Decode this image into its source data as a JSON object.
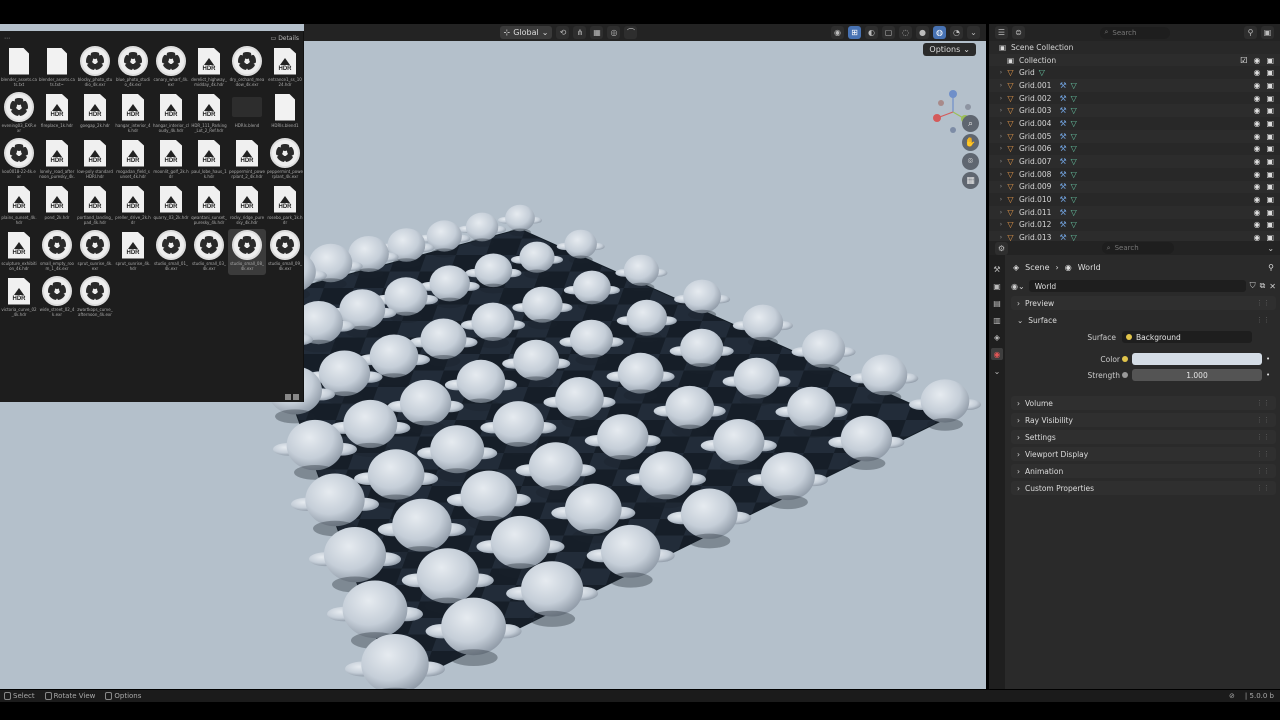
{
  "viewport": {
    "orientation": "Global",
    "options_label": "Options"
  },
  "file_browser": {
    "details_label": "Details",
    "items": [
      {
        "label": "blender_assets.cats.txt",
        "type": "doc"
      },
      {
        "label": "blender_assets.cats.txt~",
        "type": "doc"
      },
      {
        "label": "blocky_photo_studio_4k.exr",
        "type": "reel"
      },
      {
        "label": "blue_photo_studio_4k.exr",
        "type": "reel"
      },
      {
        "label": "canary_wharf_4k.exr",
        "type": "reel"
      },
      {
        "label": "derelict_highway_midday_4k.hdr",
        "type": "hdr"
      },
      {
        "label": "dry_orchard_meadow_4k.exr",
        "type": "reel"
      },
      {
        "label": "entrance1_ss_1024.hdr",
        "type": "hdr"
      },
      {
        "label": "evening03_EXR.exr",
        "type": "reel"
      },
      {
        "label": "fireplace_1k.hdr",
        "type": "hdr"
      },
      {
        "label": "goegap_2k.hdr",
        "type": "hdr"
      },
      {
        "label": "hangar_interior_4k.hdr",
        "type": "hdr"
      },
      {
        "label": "hangar_interior_cloudy_4k.hdr",
        "type": "hdr"
      },
      {
        "label": "HDR_111_Parking_Lot_2_Ref.hdr",
        "type": "hdr"
      },
      {
        "label": "HDRIs.blend",
        "type": "blend"
      },
      {
        "label": "HDRIs.blend1",
        "type": "doc"
      },
      {
        "label": "koo0018-22-4k.exr",
        "type": "reel"
      },
      {
        "label": "lonely_road_afternoon_puresky_4k.hdr",
        "type": "hdr"
      },
      {
        "label": "low-poly standard HDRI.hdr",
        "type": "hdr"
      },
      {
        "label": "mogadan_field_sunset_4k.hdr",
        "type": "hdr"
      },
      {
        "label": "moonlit_golf_2k.hdr",
        "type": "hdr"
      },
      {
        "label": "paul_lobe_haus_1k.hdr",
        "type": "hdr"
      },
      {
        "label": "peppermint_powerplant_2_4k.hdr",
        "type": "hdr"
      },
      {
        "label": "peppermint_powerplant_4k.exr",
        "type": "reel"
      },
      {
        "label": "plains_sunset_4k.hdr",
        "type": "hdr"
      },
      {
        "label": "pond_2k.hdr",
        "type": "hdr"
      },
      {
        "label": "portland_landing_pad_4k.hdr",
        "type": "hdr"
      },
      {
        "label": "preller_drive_2k.hdr",
        "type": "hdr"
      },
      {
        "label": "quarry_03_2k.hdr",
        "type": "hdr"
      },
      {
        "label": "qwantani_sunset_puresky_4k.hdr",
        "type": "hdr"
      },
      {
        "label": "rocky_ridge_puresky_4k.hdr",
        "type": "hdr"
      },
      {
        "label": "rosebo_park_1k.hdr",
        "type": "hdr"
      },
      {
        "label": "sculpture_exhibition_4k.hdr",
        "type": "hdr"
      },
      {
        "label": "small_empty_room_1_4k.exr",
        "type": "reel"
      },
      {
        "label": "sprut_sunrise_4k.exr",
        "type": "reel"
      },
      {
        "label": "sprut_sunrise_4k.hdr",
        "type": "hdr"
      },
      {
        "label": "studio_small_01_4k.exr",
        "type": "reel"
      },
      {
        "label": "studio_small_03_4k.exr",
        "type": "reel"
      },
      {
        "label": "studio_small_08_4k.exr",
        "type": "reel",
        "selected": true
      },
      {
        "label": "studio_small_09_4k.exr",
        "type": "reel"
      },
      {
        "label": "victoria_curve_02_4k.hdr",
        "type": "hdr"
      },
      {
        "label": "wide_street_02_4k.exr",
        "type": "reel"
      },
      {
        "label": "zwartkops_curve_afternoon_4k.exr",
        "type": "reel"
      }
    ]
  },
  "outliner": {
    "search_placeholder": "Search",
    "root": "Scene Collection",
    "collection": "Collection",
    "items": [
      "Grid",
      "Grid.001",
      "Grid.002",
      "Grid.003",
      "Grid.004",
      "Grid.005",
      "Grid.006",
      "Grid.007",
      "Grid.008",
      "Grid.009",
      "Grid.010",
      "Grid.011",
      "Grid.012",
      "Grid.013"
    ]
  },
  "properties": {
    "search_placeholder": "Search",
    "breadcrumb_scene": "Scene",
    "breadcrumb_world": "World",
    "world_name": "World",
    "panels_top": [
      "Preview"
    ],
    "surface_panel": "Surface",
    "surface_label": "Surface",
    "surface_value": "Background",
    "color_label": "Color",
    "color_value": "#d5dde6",
    "strength_label": "Strength",
    "strength_value": "1.000",
    "panels_bottom": [
      "Volume",
      "Ray Visibility",
      "Settings",
      "Viewport Display",
      "Animation",
      "Custom Properties"
    ]
  },
  "statusbar": {
    "select": "Select",
    "rotate": "Rotate View",
    "options": "Options",
    "version": "5.0.0 b"
  },
  "colors": {
    "viewport_bg": "#b4c0cb",
    "accent": "#4772b3",
    "world_tab": "#e15656"
  }
}
